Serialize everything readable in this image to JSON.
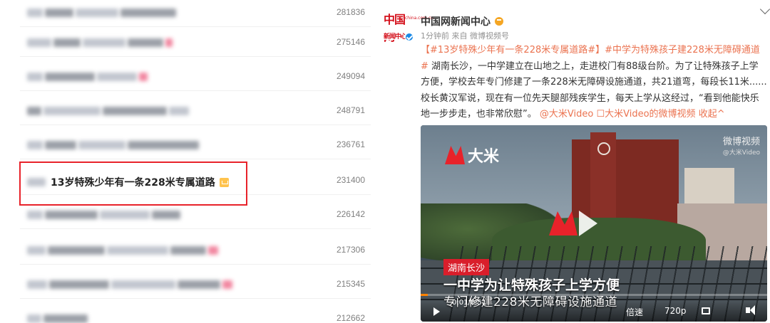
{
  "hot_list": {
    "rows": [
      {
        "title": "",
        "count": "281836"
      },
      {
        "title": "",
        "count": "275146"
      },
      {
        "title": "",
        "count": "249094"
      },
      {
        "title": "",
        "count": "248791"
      },
      {
        "title": "",
        "count": "236761"
      },
      {
        "title": "13岁特殊少年有一条228米专属道路",
        "count": "231400"
      },
      {
        "title": "",
        "count": "226142"
      },
      {
        "title": "",
        "count": "217306"
      },
      {
        "title": "",
        "count": "215345"
      },
      {
        "title": "",
        "count": "212662"
      }
    ]
  },
  "post": {
    "logo": {
      "main": "中国网",
      "sub": "china.com.cn",
      "news": "新闻中心"
    },
    "author": "中国网新闻中心",
    "meta": "1分钟前  来自 微博视频号",
    "text": {
      "topic1": "【#13岁特殊少年有一条228米专属道路#】",
      "topic2": "#中学为特殊孩子建228米无障碍通道#",
      "body": " 湖南长沙，一中学建立在山地之上，走进校门有88级台阶。为了让特殊孩子上学方便，学校去年专门修建了一条228米无障碍设施通道，共21道弯，每段长11米......校长黄汉军说，现在有一位先天腿部残疾学生，每天上学从这经过，“看到他能快乐地一步步走，也非常欣慰”。",
      "mention": "@大米Video",
      "video_link": "大米Video的微博视频",
      "collapse": "收起^"
    },
    "video": {
      "brand": "大米",
      "watermark": "微博视频",
      "watermark_sub": "@大米Video",
      "caption_location": "湖南长沙",
      "caption_main": "一中学为让特殊孩子上学方便",
      "caption_sub": "专门修建228米无障碍设施通道",
      "time": "0:01/0:51",
      "speed": "倍速",
      "quality": "720p",
      "progress": 0.02,
      "accent": "#ff8200"
    }
  }
}
